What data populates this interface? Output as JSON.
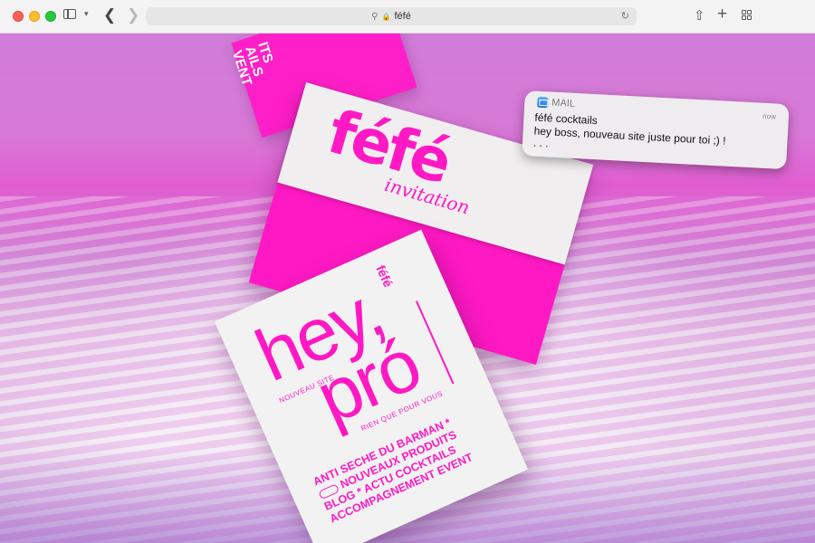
{
  "browser": {
    "address": "féfé"
  },
  "hero": {
    "back_card_text": "ITS\nAILS\nVENT",
    "envelope_logo": "féfé",
    "envelope_script": "invitation",
    "card": {
      "line1": "hey,",
      "line2": "pró",
      "tagline1": "NOUVEAU SITE",
      "tagline2": "RIEN QUE POUR VOUS",
      "side_logo": "féfé",
      "items": [
        "ANTI SECHE DU BARMAN",
        "NOUVEAUX PRODUITS",
        "BLOG",
        "ACTU COCKTAILS",
        "ACCOMPAGNEMENT EVENT"
      ],
      "star": "*"
    }
  },
  "notification": {
    "app": "MAIL",
    "time": "now",
    "title": "féfé cocktails",
    "body": "hey boss, nouveau site juste pour toi ;) !",
    "ellipsis": ". . ."
  }
}
